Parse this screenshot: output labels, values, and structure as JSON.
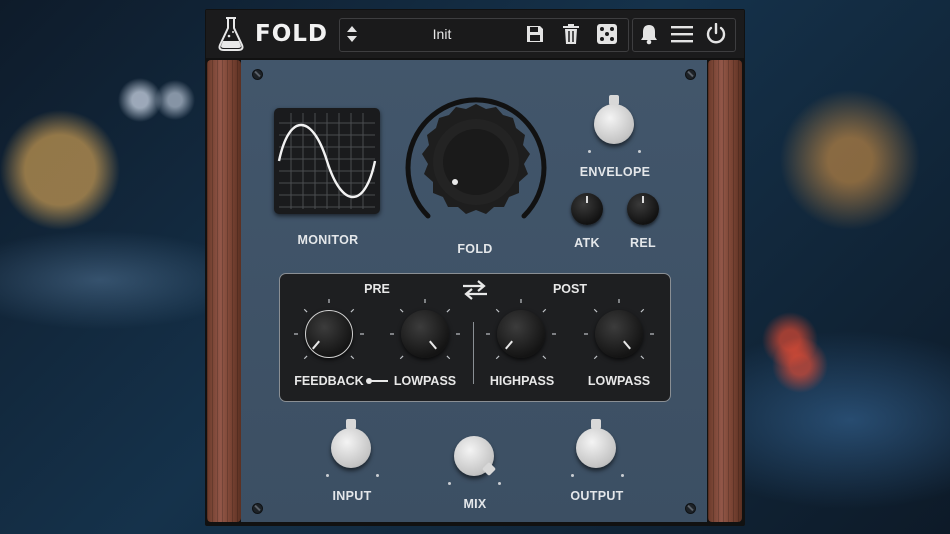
{
  "header": {
    "title": "FOLD",
    "preset_name": "Init",
    "icons": [
      "flask-icon",
      "updown-arrows-icon",
      "save-icon",
      "trash-icon",
      "dice-icon",
      "bell-icon",
      "menu-icon",
      "power-icon"
    ]
  },
  "monitor": {
    "label": "MONITOR"
  },
  "fold": {
    "label": "FOLD"
  },
  "envelope": {
    "label": "ENVELOPE",
    "atk_label": "ATK",
    "rel_label": "REL"
  },
  "filters": {
    "pre_label": "PRE",
    "post_label": "POST",
    "feedback_label": "FEEDBACK",
    "pre_lowpass_label": "LOWPASS",
    "highpass_label": "HIGHPASS",
    "post_lowpass_label": "LOWPASS"
  },
  "bottom": {
    "input_label": "INPUT",
    "mix_label": "MIX",
    "output_label": "OUTPUT"
  },
  "colors": {
    "panel": "#3f5368",
    "wood": "#7a4434",
    "topbar": "#1b1b1c",
    "accent_white": "#e4e7ea"
  }
}
